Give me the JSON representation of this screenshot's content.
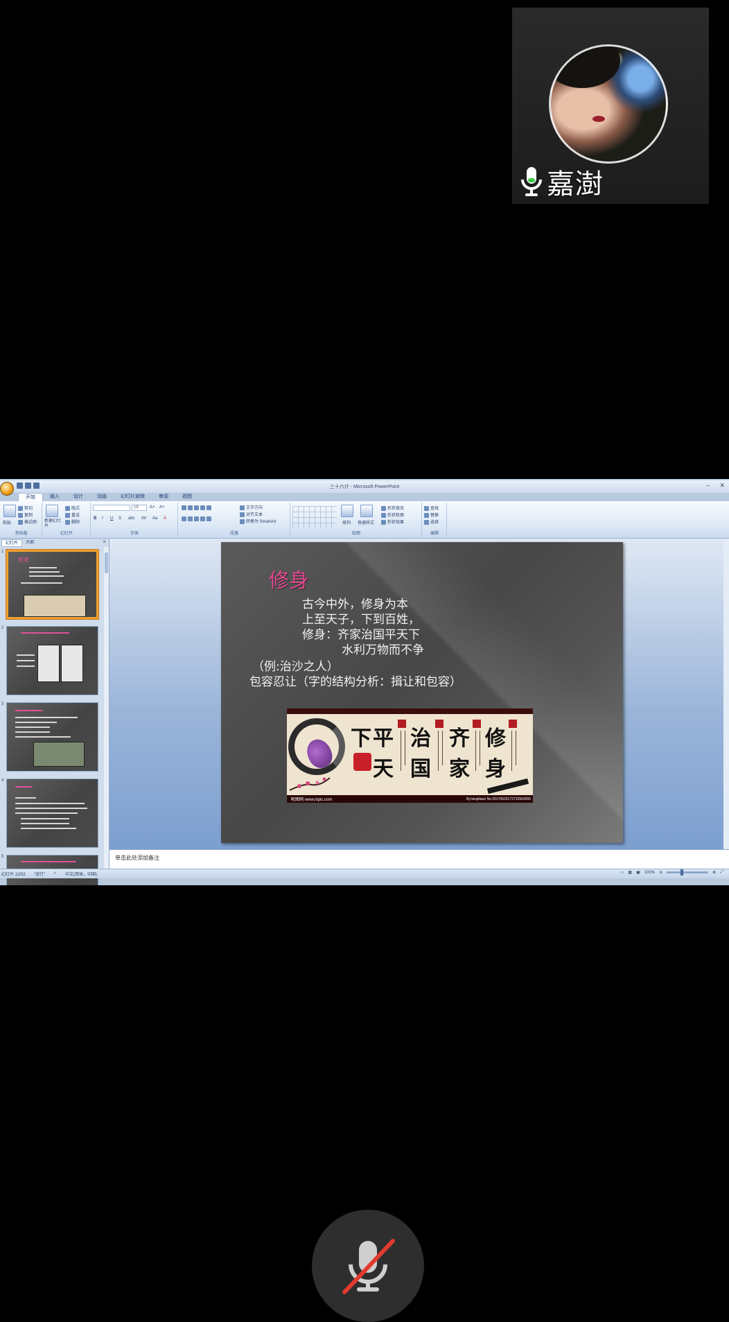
{
  "participant": {
    "name": "嘉澍",
    "mic": "on"
  },
  "controls": {
    "mute_icon": "mic-muted-icon"
  },
  "ppt": {
    "window_title": "三十六计 - Microsoft PowerPoint",
    "tabs": [
      "开始",
      "插入",
      "设计",
      "动画",
      "幻灯片放映",
      "审阅",
      "视图"
    ],
    "active_tab": "开始",
    "ribbon": {
      "groups": [
        "剪贴板",
        "幻灯片",
        "字体",
        "段落",
        "绘图",
        "编辑"
      ],
      "clipboard": {
        "paste": "粘贴",
        "cut": "剪切",
        "copy": "复制",
        "format_painter": "格式刷"
      },
      "slides": {
        "new_slide": "新建幻灯片",
        "layout": "版式",
        "reset": "重设",
        "delete": "删除"
      },
      "font": {
        "size": "18"
      },
      "paragraph": {
        "text_direction": "文字方向",
        "align_text": "对齐文本",
        "smartart": "转换为 SmartArt"
      },
      "drawing": {
        "arrange": "排列",
        "quick_styles": "快速样式",
        "shape_fill": "形状填充",
        "shape_outline": "形状轮廓",
        "shape_effects": "形状效果"
      },
      "editing": {
        "find": "查找",
        "replace": "替换",
        "select": "选择"
      }
    },
    "panel": {
      "tab_slides": "幻灯片",
      "tab_outline": "大纲",
      "close": "×"
    },
    "thumbnails": [
      {
        "num": "1"
      },
      {
        "num": "2"
      },
      {
        "num": "3"
      },
      {
        "num": "4"
      },
      {
        "num": "5"
      },
      {
        "num": "6"
      }
    ],
    "slide": {
      "title": "修身",
      "lines": [
        "古今中外，修身为本",
        "上至天子，下到百姓，",
        "修身：齐家治国平天下",
        "水利万物而不争",
        "（例:治沙之人）",
        "包容忍让（字的结构分析：揖让和包容）"
      ],
      "banner": {
        "chars": [
          "下",
          "平",
          "天",
          "治",
          "国",
          "齐",
          "家",
          "修",
          "身"
        ],
        "watermark": "昵图网 www.nipic.com",
        "credit": "By:lwujidaun No:20170629172723562000"
      }
    },
    "notes_placeholder": "单击此处添加备注",
    "status": {
      "slide_counter": "幻灯片 12/52",
      "theme": "\"流行\"",
      "language": "中文(简体，中国)",
      "zoom": "100%"
    }
  }
}
